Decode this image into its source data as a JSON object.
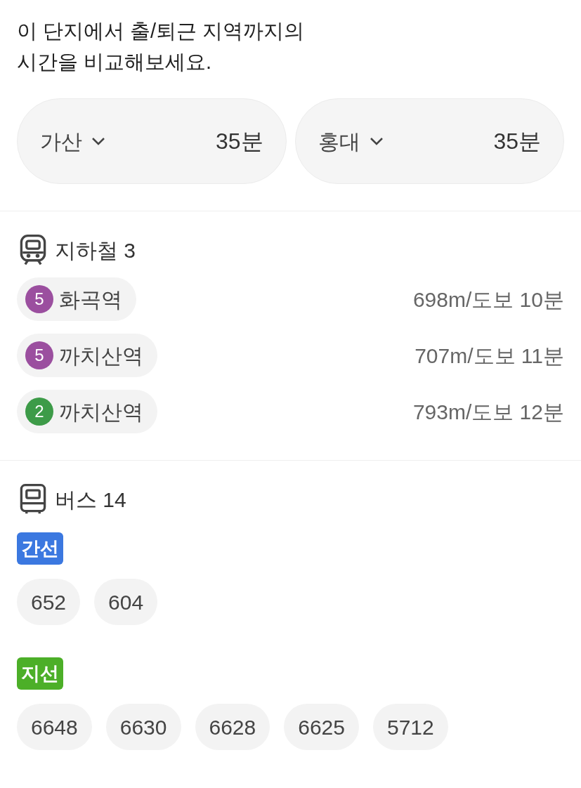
{
  "intro": "이 단지에서 출/퇴근 지역까지의\n시간을 비교해보세요.",
  "commutes": [
    {
      "place": "가산",
      "time": "35분"
    },
    {
      "place": "홍대",
      "time": "35분"
    }
  ],
  "subway": {
    "title": "지하철 3",
    "stations": [
      {
        "line": "5",
        "color": "#9b4f9f",
        "name": "화곡역",
        "distance": "698m/도보 10분"
      },
      {
        "line": "5",
        "color": "#9b4f9f",
        "name": "까치산역",
        "distance": "707m/도보 11분"
      },
      {
        "line": "2",
        "color": "#3d9b48",
        "name": "까치산역",
        "distance": "793m/도보 12분"
      }
    ]
  },
  "bus": {
    "title": "버스 14",
    "groups": [
      {
        "label": "간선",
        "color": "#3b78e0",
        "routes": [
          "652",
          "604"
        ]
      },
      {
        "label": "지선",
        "color": "#4caf28",
        "routes": [
          "6648",
          "6630",
          "6628",
          "6625",
          "5712"
        ]
      }
    ]
  }
}
